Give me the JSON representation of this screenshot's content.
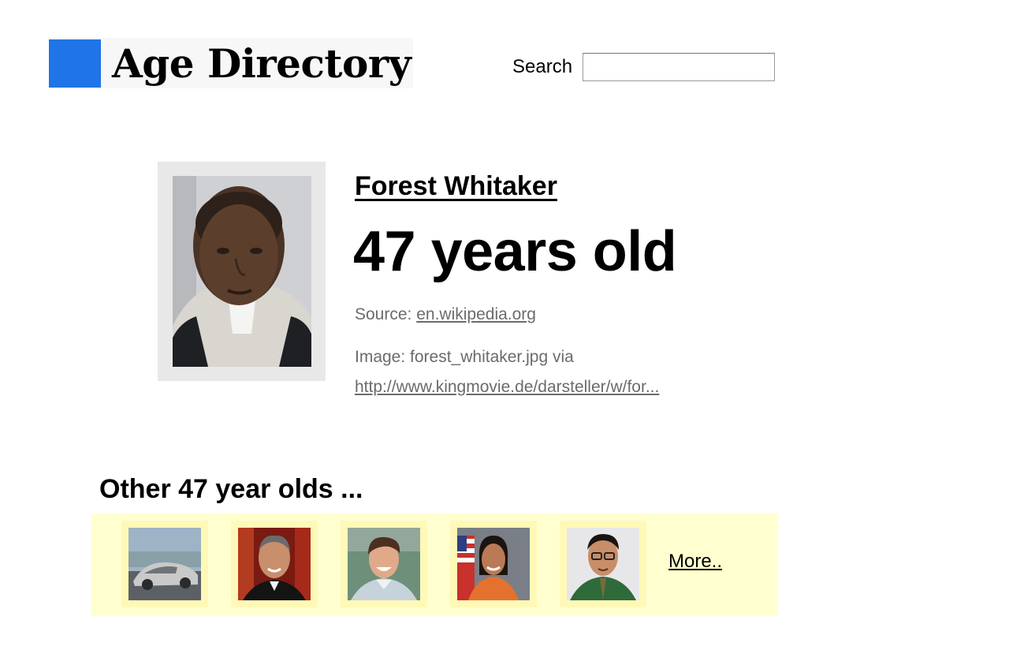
{
  "header": {
    "site_title": "Age Directory",
    "search_label": "Search",
    "search_value": ""
  },
  "profile": {
    "name": "Forest Whitaker",
    "age_text": "47 years old",
    "source_label": "Source:",
    "source_link": "en.wikipedia.org",
    "image_label": "Image: forest_whitaker.jpg via",
    "image_link": "http://www.kingmovie.de/darsteller/w/for..."
  },
  "others": {
    "heading": "Other 47 year olds ...",
    "more_label": "More..",
    "thumbnails": [
      "concept-car",
      "man-in-tuxedo",
      "smiling-man",
      "astronaut",
      "man-with-glasses"
    ]
  },
  "colors": {
    "brand_blue": "#1f74e8",
    "strip_bg": "#ffffd0",
    "thumb_bg": "#fff9b8"
  }
}
